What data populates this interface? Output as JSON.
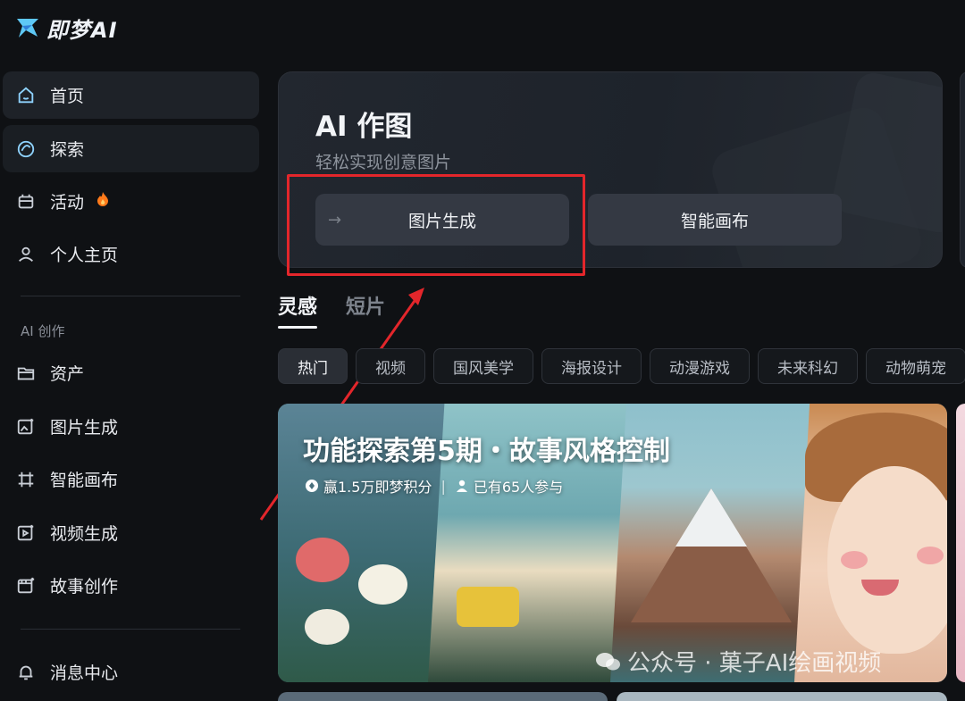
{
  "app": {
    "logo_text": "即梦AI"
  },
  "sidebar": {
    "items": [
      {
        "label": "首页",
        "icon": "home-icon"
      },
      {
        "label": "探索",
        "icon": "explore-icon"
      },
      {
        "label": "活动",
        "icon": "activity-icon",
        "badge": "fire-icon"
      },
      {
        "label": "个人主页",
        "icon": "profile-icon"
      }
    ],
    "section_label": "AI 创作",
    "creation_items": [
      {
        "label": "资产",
        "icon": "folder-icon"
      },
      {
        "label": "图片生成",
        "icon": "image-gen-icon"
      },
      {
        "label": "智能画布",
        "icon": "canvas-icon"
      },
      {
        "label": "视频生成",
        "icon": "video-gen-icon"
      },
      {
        "label": "故事创作",
        "icon": "story-icon"
      }
    ],
    "bottom_items": [
      {
        "label": "消息中心",
        "icon": "bell-icon"
      }
    ]
  },
  "hero": {
    "title": "AI 作图",
    "subtitle": "轻松实现创意图片",
    "buttons": [
      {
        "label": "图片生成"
      },
      {
        "label": "智能画布"
      }
    ]
  },
  "tabs": [
    {
      "label": "灵感",
      "active": true
    },
    {
      "label": "短片",
      "active": false
    }
  ],
  "chips": [
    "热门",
    "视频",
    "国风美学",
    "海报设计",
    "动漫游戏",
    "未来科幻",
    "动物萌宠"
  ],
  "banner": {
    "title": "功能探索第5期・故事风格控制",
    "reward": "赢1.5万即梦积分",
    "separator": "|",
    "participants": "已有65人参与",
    "watermark": "公众号 · 菓子AI绘画视频"
  },
  "colors": {
    "accent_annotation": "#e3262b",
    "background": "#0f1114",
    "card": "#1e232b"
  }
}
